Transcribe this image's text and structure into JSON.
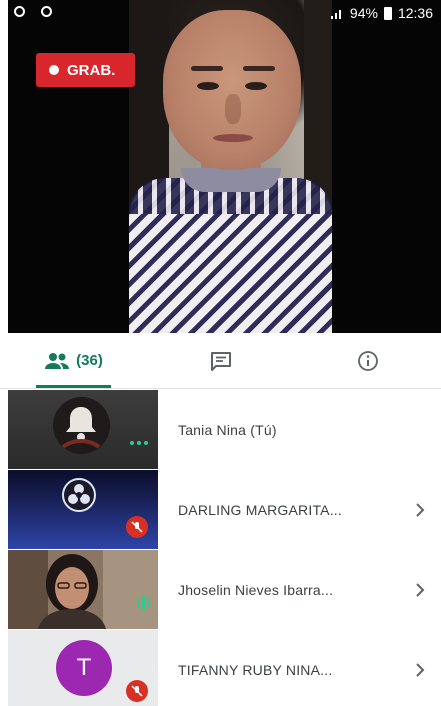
{
  "status_bar": {
    "battery": "94%",
    "time": "12:36"
  },
  "recording": {
    "label": "GRAB."
  },
  "tabs": [
    {
      "name": "people",
      "count": "(36)",
      "icon": "people-icon",
      "active": true
    },
    {
      "name": "chat",
      "icon": "chat-icon",
      "active": false
    },
    {
      "name": "info",
      "icon": "info-icon",
      "active": false
    }
  ],
  "participants": [
    {
      "name": "Tania Nina (Tú)"
    },
    {
      "name": "DARLING MARGARITA..."
    },
    {
      "name": "Jhoselin Nieves Ibarra..."
    },
    {
      "name": "TIFANNY RUBY NINA...",
      "initial": "T"
    }
  ],
  "colors": {
    "accent": "#137a5a",
    "record": "#d8262d",
    "mute": "#d93025",
    "avatar_purple": "#9c27b0",
    "speaking": "#35c88c"
  }
}
